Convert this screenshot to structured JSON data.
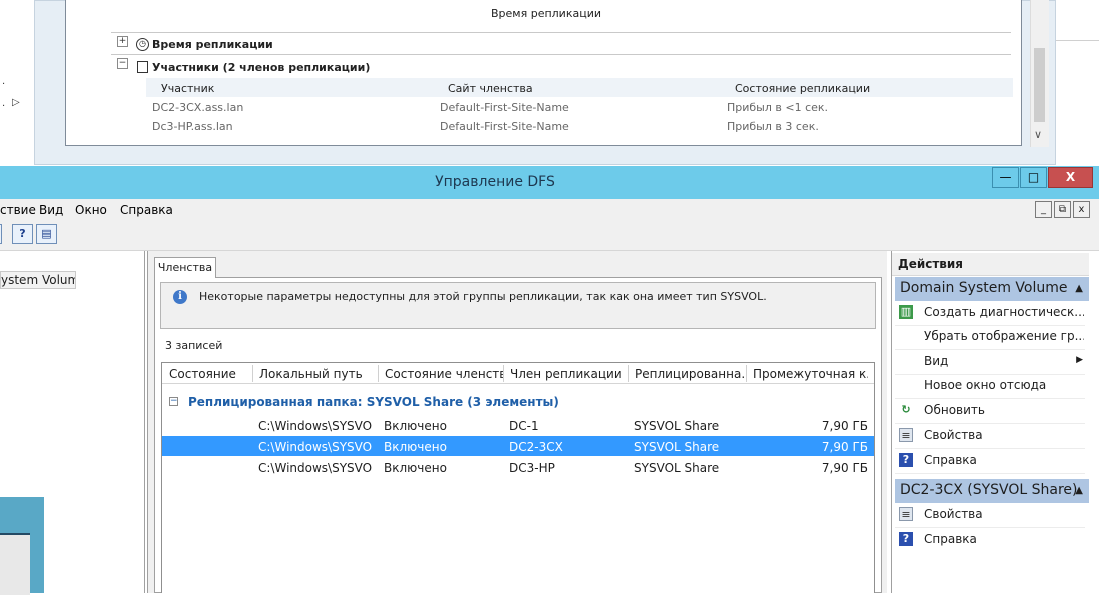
{
  "background_window": {
    "section_heading": "Время репликации",
    "sections": [
      {
        "label": "Время репликации",
        "toggle": "+"
      },
      {
        "label": "Участники (2 членов репликации)",
        "toggle": "−"
      }
    ],
    "columns": [
      "Участник",
      "Сайт членства",
      "Состояние репликации"
    ],
    "rows": [
      [
        "DC2-3CX.ass.lan",
        "Default-First-Site-Name",
        "Прибыл в <1 сек."
      ],
      [
        "Dc3-HP.ass.lan",
        "Default-First-Site-Name",
        "Прибыл в 3 сек."
      ]
    ]
  },
  "window": {
    "title": "Управление DFS",
    "caption_buttons": [
      "—",
      "□",
      "X"
    ],
    "mdi_buttons": [
      "_",
      "⧉",
      "x"
    ]
  },
  "menu": [
    "ствие",
    "Вид",
    "Окно",
    "Справка"
  ],
  "tree": {
    "selected_item": "ystem Volume"
  },
  "center": {
    "tab_label": "Членства",
    "info_message": "Некоторые параметры недоступны для этой группы репликации, так как она имеет тип SYSVOL.",
    "record_count": "3 записей",
    "columns": [
      "Состояние",
      "Локальный путь",
      "Состояние членства",
      "Член репликации",
      "Реплицированна...",
      "Промежуточная к..."
    ],
    "group_label": "Реплицированная папка: SYSVOL Share (3 элементы)",
    "group_toggle": "−",
    "rows": [
      {
        "state": "",
        "path": "C:\\Windows\\SYSVOL...",
        "membership": "Включено",
        "member": "DC-1",
        "folder": "SYSVOL Share",
        "staging": "7,90 ГБ",
        "selected": false
      },
      {
        "state": "",
        "path": "C:\\Windows\\SYSVOL...",
        "membership": "Включено",
        "member": "DC2-3CX",
        "folder": "SYSVOL Share",
        "staging": "7,90 ГБ",
        "selected": true
      },
      {
        "state": "",
        "path": "C:\\Windows\\SYSVOL...",
        "membership": "Включено",
        "member": "DC3-HP",
        "folder": "SYSVOL Share",
        "staging": "7,90 ГБ",
        "selected": false
      }
    ]
  },
  "actions": {
    "title": "Действия",
    "section1": {
      "label": "Domain System Volume",
      "items": [
        {
          "label": "Создать диагностическ...",
          "icon": "report-icon"
        },
        {
          "label": "Убрать отображение гр...",
          "icon": ""
        },
        {
          "label": "Вид",
          "icon": ""
        },
        {
          "label": "Новое окно отсюда",
          "icon": ""
        },
        {
          "label": "Обновить",
          "icon": "refresh-icon"
        },
        {
          "label": "Свойства",
          "icon": "properties-icon"
        },
        {
          "label": "Справка",
          "icon": "help-icon"
        }
      ]
    },
    "section2": {
      "label": "DC2-3CX (SYSVOL Share)",
      "items": [
        {
          "label": "Свойства",
          "icon": "properties-icon"
        },
        {
          "label": "Справка",
          "icon": "help-icon"
        }
      ]
    }
  },
  "colors": {
    "titlebar": "#6dcbea",
    "selection": "#3399ff",
    "action_section": "#aec5e2",
    "group_text": "#1f5fa8"
  }
}
